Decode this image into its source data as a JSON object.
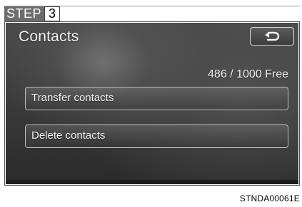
{
  "step": {
    "label": "STEP",
    "number": "3"
  },
  "screen": {
    "title": "Contacts",
    "free_count": "486 / 1000 Free",
    "buttons": [
      {
        "label": "Transfer contacts"
      },
      {
        "label": "Delete contacts"
      }
    ],
    "back_icon": "back-arrow-icon"
  },
  "figure_code": "STNDA00061E",
  "colors": {
    "screen_bg": "#3a3a3a",
    "text": "#f2f2f2",
    "step_bg": "#6d6d6d"
  }
}
